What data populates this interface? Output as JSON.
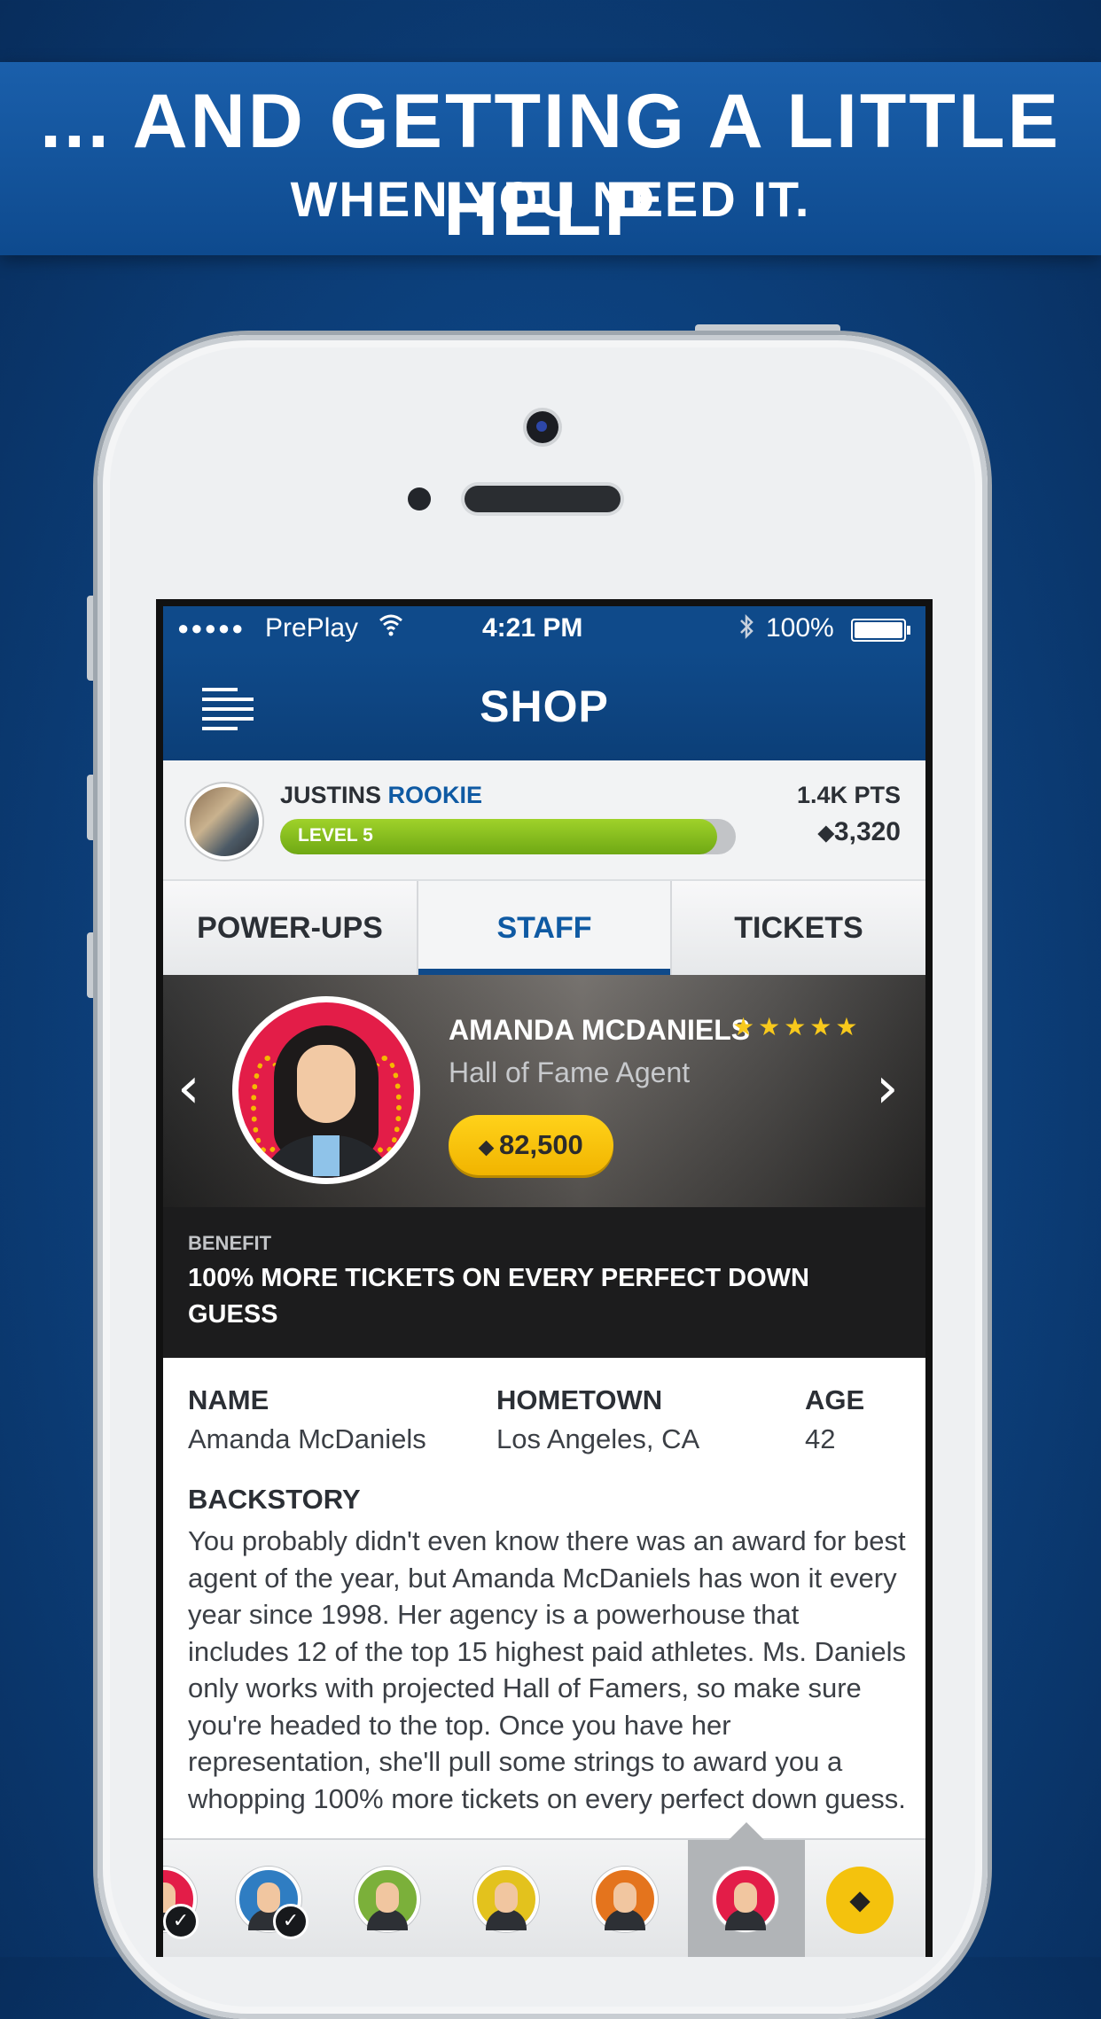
{
  "banner": {
    "line1": "... AND GETTING A LITTLE HELP",
    "line2": "WHEN YOU NEED IT."
  },
  "status_bar": {
    "signal": "●●●●●",
    "carrier": "PrePlay",
    "time": "4:21 PM",
    "battery": "100%"
  },
  "nav": {
    "title": "SHOP"
  },
  "profile": {
    "name": "JUSTINS",
    "rank": "ROOKIE",
    "level_label": "LEVEL 5",
    "level_progress": 0.96,
    "points": "1.4K PTS",
    "tickets": "3,320"
  },
  "tabs": [
    {
      "label": "POWER-UPS",
      "active": false
    },
    {
      "label": "STAFF",
      "active": true
    },
    {
      "label": "TICKETS",
      "active": false
    }
  ],
  "staff": {
    "name": "AMANDA MCDANIELS",
    "rating": 5,
    "stars": "★★★★★",
    "title": "Hall of Fame Agent",
    "price": "82,500"
  },
  "benefit": {
    "label": "BENEFIT",
    "text": "100% MORE TICKETS ON EVERY PERFECT DOWN GUESS"
  },
  "details": {
    "name_label": "NAME",
    "name_value": "Amanda McDaniels",
    "hometown_label": "HOMETOWN",
    "hometown_value": "Los Angeles, CA",
    "age_label": "AGE",
    "age_value": "42",
    "backstory_label": "BACKSTORY",
    "backstory": "You probably didn't even know there was an award for best agent of the year, but Amanda McDaniels has won it every year since 1998. Her agency is a powerhouse that includes 12 of the top 15 highest paid athletes. Ms. Daniels only works with projected Hall of Famers, so make sure you're headed to the top. Once you have her representation, she'll pull some strings to award you a whopping 100% more tickets on every perfect down guess."
  },
  "colors": {
    "nav_blue": "#0f4a8a",
    "accent_blue": "#0f5aa3",
    "level_green": "#8cc21f",
    "price_yellow": "#f8c91c",
    "benefit_bg": "#1c1c1d"
  }
}
